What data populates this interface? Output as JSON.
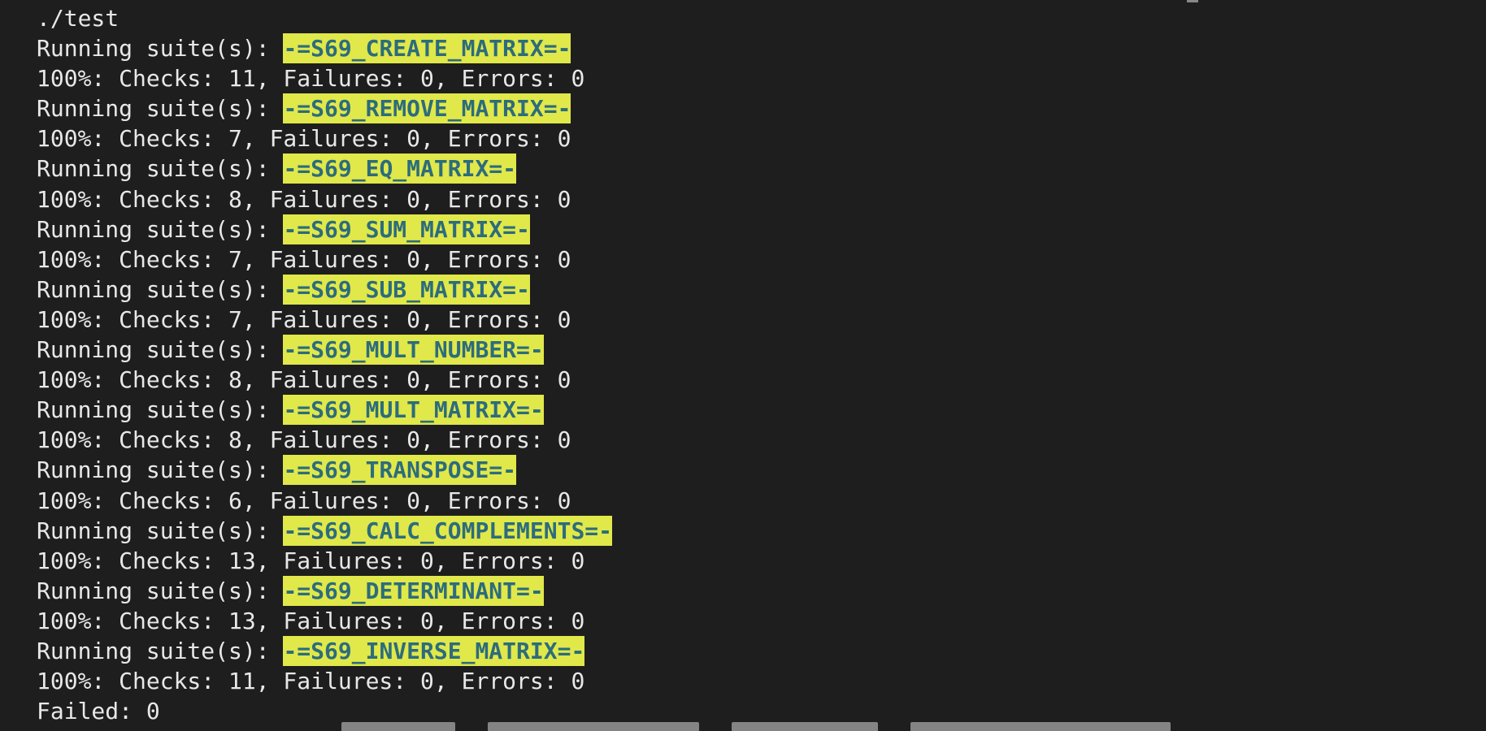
{
  "terminal": {
    "command": "./test",
    "suite_prefix": "Running suite(s): ",
    "suites": [
      {
        "name": "-=S69_CREATE_MATRIX=-",
        "result": "100%: Checks: 11, Failures: 0, Errors: 0"
      },
      {
        "name": "-=S69_REMOVE_MATRIX=-",
        "result": "100%: Checks: 7, Failures: 0, Errors: 0"
      },
      {
        "name": "-=S69_EQ_MATRIX=-",
        "result": "100%: Checks: 8, Failures: 0, Errors: 0"
      },
      {
        "name": "-=S69_SUM_MATRIX=-",
        "result": "100%: Checks: 7, Failures: 0, Errors: 0"
      },
      {
        "name": "-=S69_SUB_MATRIX=-",
        "result": "100%: Checks: 7, Failures: 0, Errors: 0"
      },
      {
        "name": "-=S69_MULT_NUMBER=-",
        "result": "100%: Checks: 8, Failures: 0, Errors: 0"
      },
      {
        "name": "-=S69_MULT_MATRIX=-",
        "result": "100%: Checks: 8, Failures: 0, Errors: 0"
      },
      {
        "name": "-=S69_TRANSPOSE=-",
        "result": "100%: Checks: 6, Failures: 0, Errors: 0"
      },
      {
        "name": "-=S69_CALC_COMPLEMENTS=-",
        "result": "100%: Checks: 13, Failures: 0, Errors: 0"
      },
      {
        "name": "-=S69_DETERMINANT=-",
        "result": "100%: Checks: 13, Failures: 0, Errors: 0"
      },
      {
        "name": "-=S69_INVERSE_MATRIX=-",
        "result": "100%: Checks: 11, Failures: 0, Errors: 0"
      }
    ],
    "summary": "Failed: 0"
  },
  "colors": {
    "background": "#1e1e1e",
    "text": "#e8e8e8",
    "suite_highlight": "#e0e84a",
    "suite_text": "#2c6c7c"
  }
}
